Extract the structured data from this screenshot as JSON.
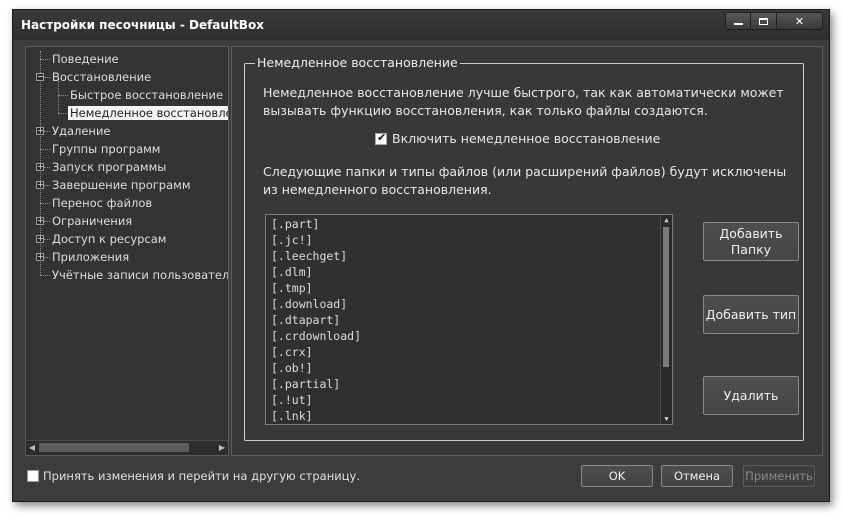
{
  "window": {
    "title": "Настройки песочницы - DefaultBox"
  },
  "tree": {
    "items": [
      {
        "label": "Поведение",
        "level": 0,
        "expander": "",
        "selected": false
      },
      {
        "label": "Восстановление",
        "level": 0,
        "expander": "−",
        "selected": false
      },
      {
        "label": "Быстрое восстановление",
        "level": 1,
        "expander": "",
        "selected": false
      },
      {
        "label": "Немедленное восстановление",
        "level": 1,
        "expander": "",
        "selected": true
      },
      {
        "label": "Удаление",
        "level": 0,
        "expander": "+",
        "selected": false
      },
      {
        "label": "Группы программ",
        "level": 0,
        "expander": "",
        "selected": false
      },
      {
        "label": "Запуск программы",
        "level": 0,
        "expander": "+",
        "selected": false
      },
      {
        "label": "Завершение программ",
        "level": 0,
        "expander": "+",
        "selected": false
      },
      {
        "label": "Перенос файлов",
        "level": 0,
        "expander": "",
        "selected": false
      },
      {
        "label": "Ограничения",
        "level": 0,
        "expander": "+",
        "selected": false
      },
      {
        "label": "Доступ к ресурсам",
        "level": 0,
        "expander": "+",
        "selected": false
      },
      {
        "label": "Приложения",
        "level": 0,
        "expander": "+",
        "selected": false
      },
      {
        "label": "Учётные записи пользователей",
        "level": 0,
        "expander": "",
        "selected": false
      }
    ]
  },
  "panel": {
    "group_title": "Немедленное восстановление",
    "desc1_line1": "Немедленное восстановление лучше быстрого, так как автоматически может",
    "desc1_line2": "вызывать функцию восстановления, как только файлы создаются.",
    "enable_checkbox_label": "Включить немедленное восстановление",
    "enable_checked": true,
    "desc2_line1": "Следующие папки и типы файлов (или расширений файлов) будут исключены",
    "desc2_line2": "из немедленного восстановления.",
    "exclusions": [
      "[.part]",
      "[.jc!]",
      "[.leechget]",
      "[.dlm]",
      "[.tmp]",
      "[.download]",
      "[.dtapart]",
      "[.crdownload]",
      "[.crx]",
      "[.ob!]",
      "[.partial]",
      "[.!ut]",
      "[.lnk]"
    ],
    "add_folder_label_line1": "Добавить",
    "add_folder_label_line2": "Папку",
    "add_type_label": "Добавить тип",
    "delete_label": "Удалить"
  },
  "footer": {
    "apply_and_go_label": "Принять изменения и перейти на другую страницу.",
    "apply_and_go_checked": false,
    "ok_label": "OK",
    "cancel_label": "Отмена",
    "apply_label": "Применить"
  }
}
